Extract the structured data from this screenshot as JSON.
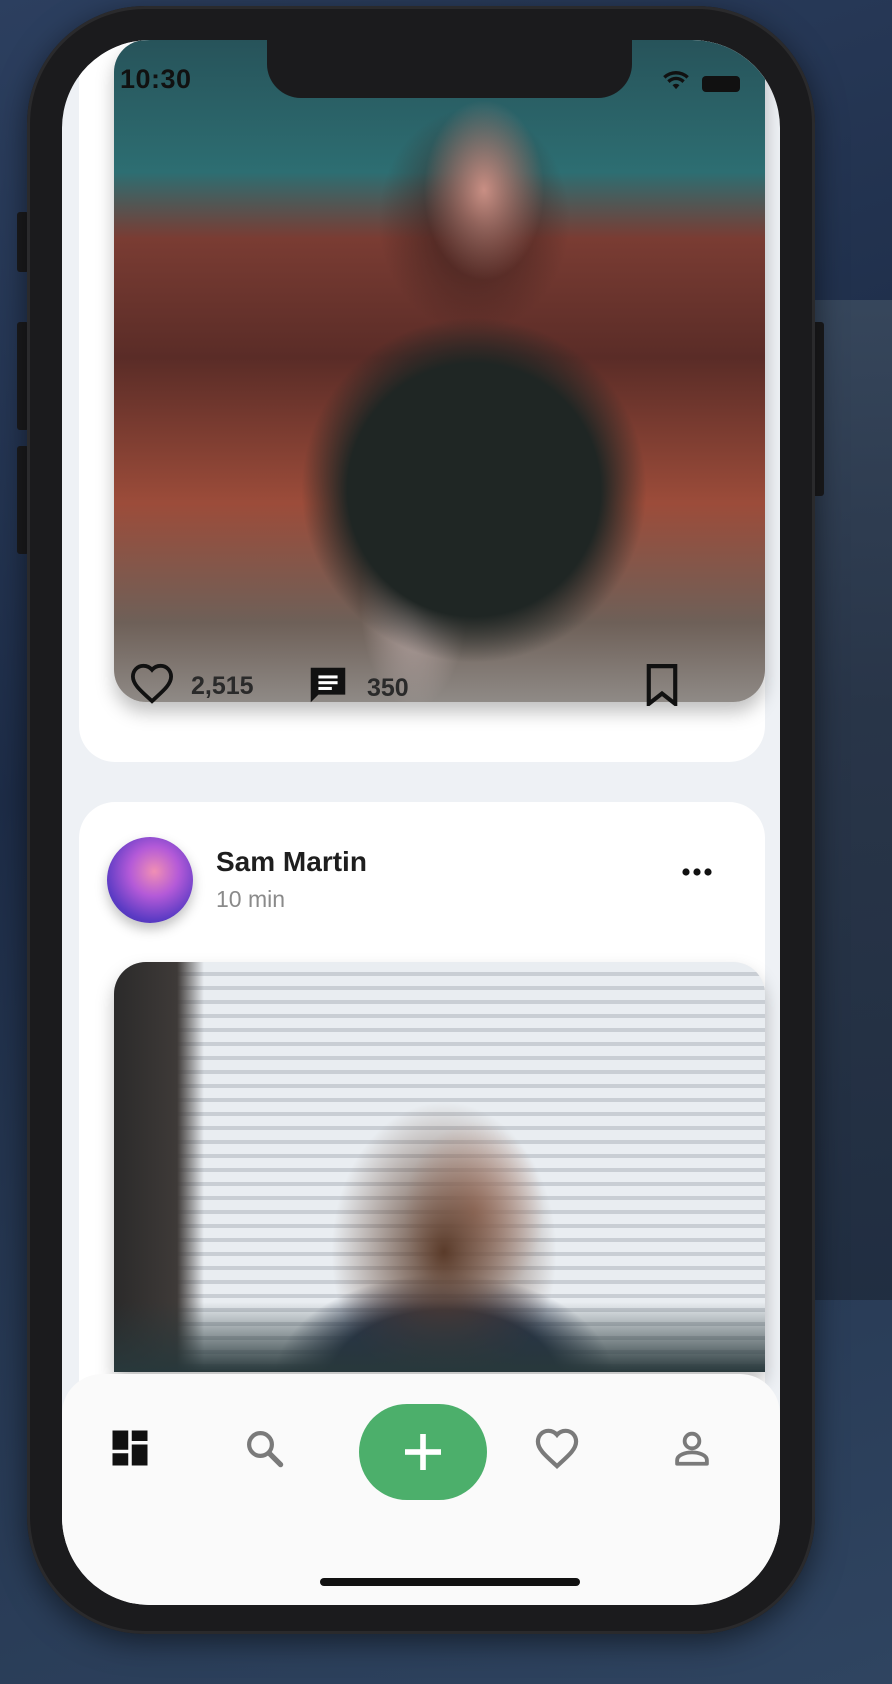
{
  "status_bar": {
    "time": "10:30"
  },
  "post1": {
    "likes": "2,515",
    "comments": "350"
  },
  "post2": {
    "author": "Sam Martin",
    "time_ago": "10 min"
  },
  "nav": {
    "items": [
      "dashboard-icon",
      "search-icon",
      "add-icon",
      "heart-icon",
      "profile-icon"
    ],
    "accent": "#4caf6b"
  }
}
